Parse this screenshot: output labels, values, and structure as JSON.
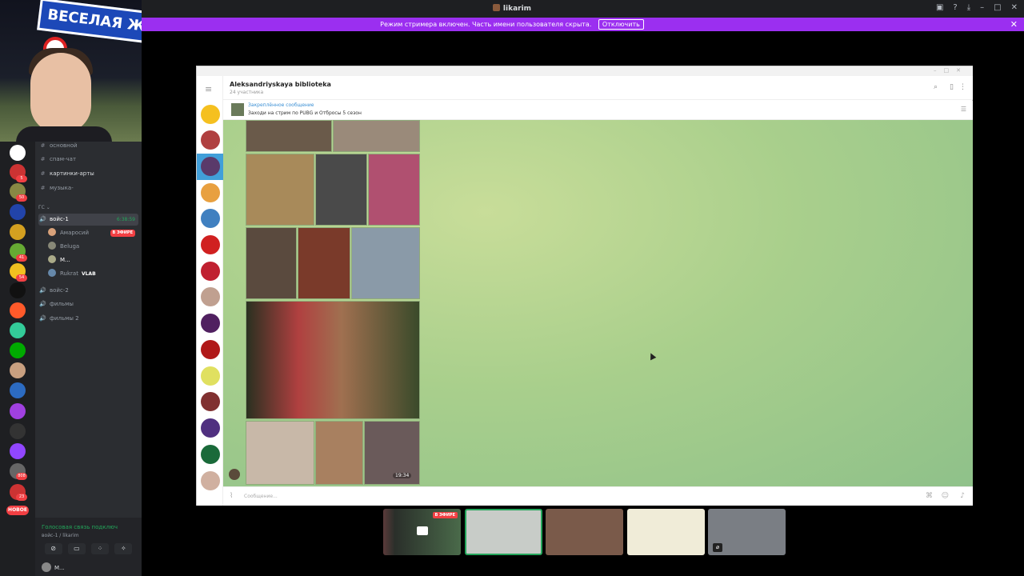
{
  "window": {
    "title": "likarim"
  },
  "streamer_bar": {
    "text": "Режим стримера включен. Часть имени пользователя скрыта.",
    "button": "Отключить"
  },
  "webcam": {
    "sign_text": "ВЕСЕЛАЯ ЖИЗ"
  },
  "guild_badges": [
    "5",
    "50",
    "41",
    "54",
    "38",
    "32",
    "808",
    "23"
  ],
  "new_badge": "НОВОЕ",
  "channels": {
    "items": [
      {
        "label": "основной"
      },
      {
        "label": "спам-чат"
      },
      {
        "label": "картинки-арты"
      },
      {
        "label": "музыка-"
      }
    ],
    "category": "ГС",
    "voice1": {
      "label": "войс-1",
      "time": "6:38:59"
    },
    "voice_users": [
      {
        "name": "Амаросий",
        "badge": "В ЭФИРЕ"
      },
      {
        "name": "Beluga"
      },
      {
        "name": "M..."
      },
      {
        "name": "Rukrat",
        "tag": "VLAB"
      }
    ],
    "voice2": {
      "label": "войс-2"
    },
    "voice3": {
      "label": "фильмы"
    },
    "voice4": {
      "label": "фильмы 2"
    }
  },
  "voice_panel": {
    "status": "Голосовая связь подключ",
    "sub": "войс-1 / likarim",
    "user": "M..."
  },
  "telegram": {
    "chat_name": "Aleksandriyskaya biblioteka",
    "members": "24 участника",
    "pinned_title": "Закреплённое сообщение",
    "pinned_text": "Заходи на стрим по PUBG и Отбросы 5 сезон",
    "message_time": "19:34",
    "input_placeholder": "Сообщение..."
  },
  "stream_tiles": [
    {
      "live": "В ЭФИРЕ"
    }
  ],
  "colors": {
    "discord_bg": "#2b2d31",
    "streamer_bar": "#9b2ff0",
    "telegram_accent": "#419fd9"
  }
}
